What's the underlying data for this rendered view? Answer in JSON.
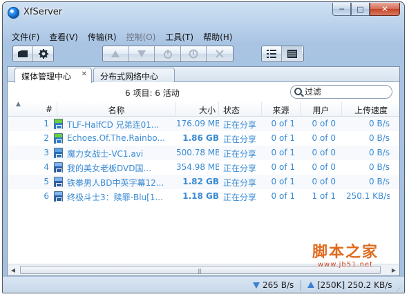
{
  "window": {
    "title": "XfServer"
  },
  "caption_buttons": {
    "minimize": "─",
    "maximize": "□",
    "close": "✕"
  },
  "menu": [
    {
      "label": "文件(F)",
      "enabled": true
    },
    {
      "label": "查看(V)",
      "enabled": true
    },
    {
      "label": "传输(R)",
      "enabled": true
    },
    {
      "label": "控制(O)",
      "enabled": false
    },
    {
      "label": "工具(T)",
      "enabled": true
    },
    {
      "label": "帮助(H)",
      "enabled": true
    }
  ],
  "tabs": [
    {
      "label": "媒体管理中心",
      "active": true,
      "close": "✕"
    },
    {
      "label": "分布式网络中心",
      "active": false
    }
  ],
  "stats": {
    "summary": "6 项目: 6 活动"
  },
  "filter": {
    "placeholder": "过滤"
  },
  "table": {
    "columns": [
      "#",
      "名称",
      "大小",
      "状态",
      "来源",
      "用户",
      "上传速度"
    ],
    "rows": [
      {
        "num": "1",
        "name": "TLF-HalfCD 兄弟连01...",
        "size": "176.09 MB",
        "size_bold": false,
        "status": "正在分享",
        "source": "0 of 1",
        "users": "0 of 0",
        "upload": "0 B/s",
        "icon": "mkv"
      },
      {
        "num": "2",
        "name": "Echoes.Of.The.Rainbo...",
        "size": "1.86 GB",
        "size_bold": true,
        "status": "正在分享",
        "source": "0 of 1",
        "users": "0 of 0",
        "upload": "0 B/s",
        "icon": "mkv"
      },
      {
        "num": "3",
        "name": "魔力女战士-VC1.avi",
        "size": "500.78 MB",
        "size_bold": false,
        "status": "正在分享",
        "source": "0 of 1",
        "users": "0 of 0",
        "upload": "0 B/s",
        "icon": "avi"
      },
      {
        "num": "4",
        "name": "我的美女老板DVD国...",
        "size": "354.98 MB",
        "size_bold": false,
        "status": "正在分享",
        "source": "0 of 1",
        "users": "0 of 0",
        "upload": "0 B/s",
        "icon": "rmvb"
      },
      {
        "num": "5",
        "name": "铁拳男人BD中英字幕12...",
        "size": "1.82 GB",
        "size_bold": true,
        "status": "正在分享",
        "source": "0 of 1",
        "users": "0 of 0",
        "upload": "0 B/s",
        "icon": "rmvb"
      },
      {
        "num": "6",
        "name": "终极斗士3：赎罪-Blu[1...",
        "size": "1.18 GB",
        "size_bold": true,
        "status": "正在分享",
        "source": "0 of 1",
        "users": "1 of 1",
        "upload": "250.1 KB/s",
        "icon": "rmvb"
      }
    ]
  },
  "statusbar": {
    "download_speed": "265 B/s",
    "upload_speed": "[250K] 250.2 KB/s"
  },
  "watermark": {
    "title": "脚本之家",
    "url": "www.jb51.net"
  },
  "colors": {
    "row_text": "#3a8bd4",
    "chrome": "#a9c4e3",
    "watermark": "#e06b1f"
  }
}
